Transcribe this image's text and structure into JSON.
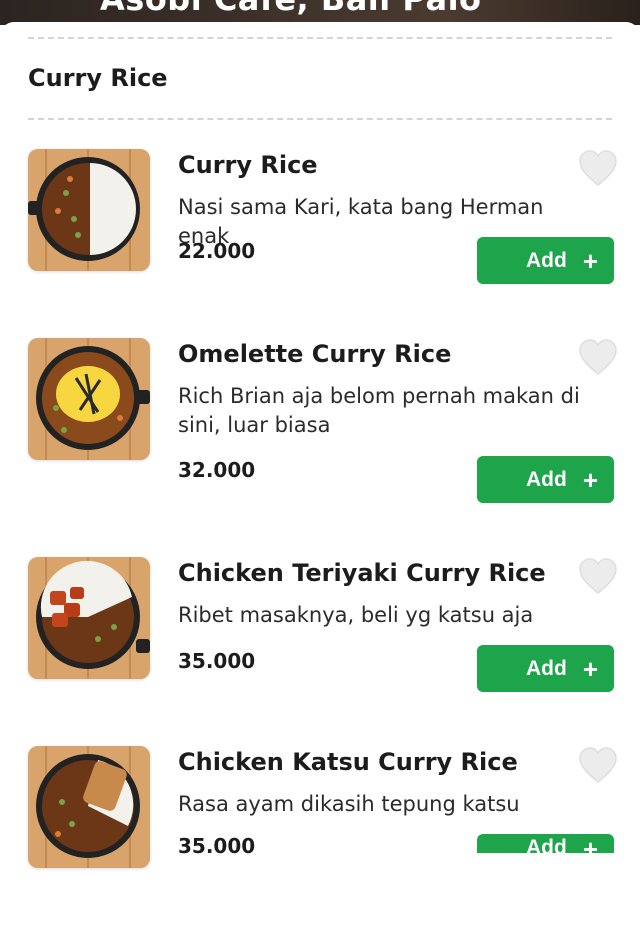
{
  "header": {
    "restaurant_title": "Asobi Cafe, Bali Palo"
  },
  "section": {
    "title": "Curry Rice"
  },
  "colors": {
    "accent": "#1ea44b",
    "favorite_outline": "#e6e6e6"
  },
  "items": [
    {
      "name": "Curry Rice",
      "description": "Nasi sama Kari, kata bang Herman enak",
      "price": "22.000",
      "add_label": "Add",
      "icon": "plus-icon"
    },
    {
      "name": "Omelette Curry Rice",
      "description": "Rich Brian aja belom pernah makan di sini, luar biasa",
      "price": "32.000",
      "add_label": "Add",
      "icon": "plus-icon"
    },
    {
      "name": "Chicken Teriyaki Curry Rice",
      "description": "Ribet masaknya, beli yg katsu aja",
      "price": "35.000",
      "add_label": "Add",
      "icon": "plus-icon"
    },
    {
      "name": "Chicken Katsu Curry Rice",
      "description": "Rasa ayam dikasih tepung katsu",
      "price": "35.000",
      "add_label": "Add",
      "icon": "plus-icon"
    }
  ]
}
